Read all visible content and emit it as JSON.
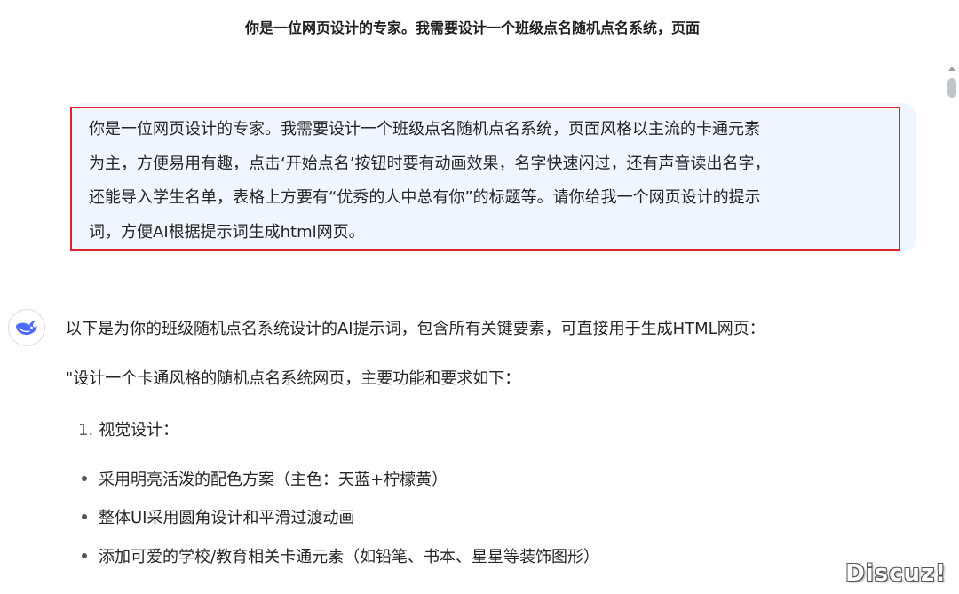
{
  "conversation": {
    "title": "你是一位网页设计的专家。我需要设计一个班级点名随机点名系统，页面"
  },
  "user_message": {
    "lines": [
      "你是一位网页设计的专家。我需要设计一个班级点名随机点名系统，页面风格以主流的卡通元素",
      "为主，方便易用有趣，点击‘开始点名’按钮时要有动画效果，名字快速闪过，还有声音读出名字，",
      "还能导入学生名单，表格上方要有“优秀的人中总有你”的标题等。请你给我一个网页设计的提示",
      "词，方便AI根据提示词生成html网页。"
    ]
  },
  "assistant_message": {
    "avatar_icon": "whale-icon",
    "intro": "以下是为你的班级随机点名系统设计的AI提示词，包含所有关键要素，可直接用于生成HTML网页：",
    "prompt_open": "\"设计一个卡通风格的随机点名系统网页，主要功能和要求如下：",
    "section_1": {
      "number": "1.",
      "label": "视觉设计："
    },
    "bullets": [
      "采用明亮活泼的配色方案（主色：天蓝+柠檬黄）",
      "整体UI采用圆角设计和平滑过渡动画",
      "添加可爱的学校/教育相关卡通元素（如铅笔、书本、星星等装饰图形）"
    ]
  },
  "watermark": {
    "text": "Discuz!"
  },
  "colors": {
    "user_bubble": "#eff6ff",
    "highlight_border": "#e0242c",
    "avatar_accent": "#4d6bfe"
  }
}
